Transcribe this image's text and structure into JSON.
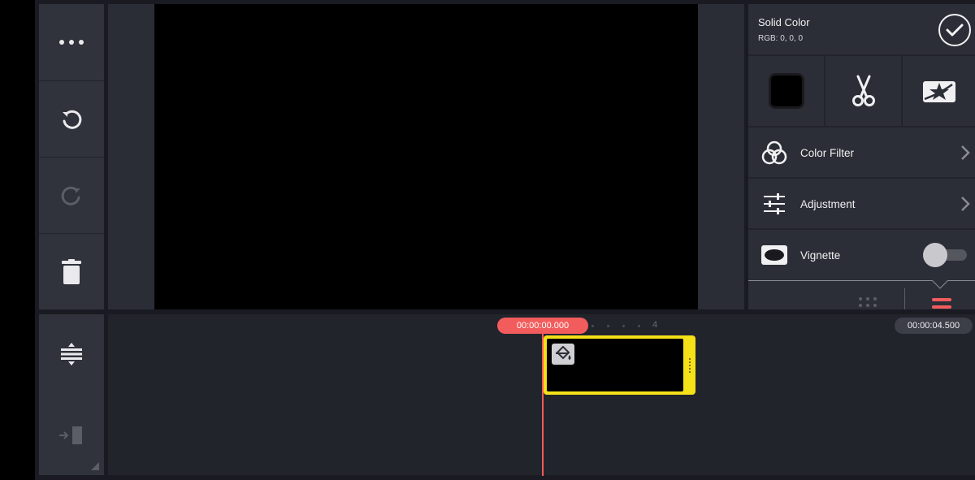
{
  "panel": {
    "title": "Solid Color",
    "subtitle": "RGB: 0, 0, 0",
    "menu": [
      {
        "label": "Color Filter"
      },
      {
        "label": "Adjustment"
      },
      {
        "label": "Vignette",
        "enabled": false
      }
    ]
  },
  "timeline": {
    "current_time": "00:00:00.000",
    "end_time": "00:00:04.500",
    "ruler_mark": "4"
  },
  "colors": {
    "accent": "#f25c5c",
    "clip_border": "#f4e118",
    "panel_bg": "#2c2e37"
  },
  "icons": {
    "toolbar": [
      "more-icon",
      "undo-icon",
      "redo-icon",
      "delete-icon"
    ],
    "timeline_tools": [
      "track-height-icon",
      "insert-icon"
    ],
    "panel_tools": [
      "color-swatch",
      "scissors-icon",
      "sticker-icon"
    ]
  }
}
